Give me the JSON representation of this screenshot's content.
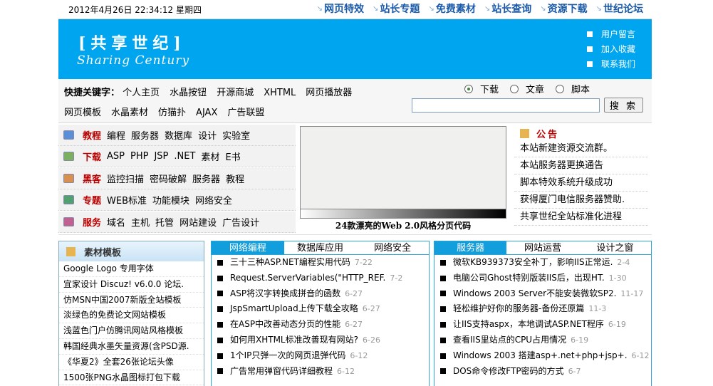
{
  "header": {
    "datetime": "2012年4月26日 22:34:12 星期四",
    "nav": [
      "网页特效",
      "站长专题",
      "免费素材",
      "站长查询",
      "资源下载",
      "世纪论坛"
    ]
  },
  "banner": {
    "logo_cn": "[共享世纪]",
    "logo_en": "Sharing Century",
    "links": [
      "用户留言",
      "加入收藏",
      "联系我们"
    ]
  },
  "search": {
    "keywords_label": "快捷关键字：",
    "keywords": [
      "个人主页",
      "水晶按钮",
      "开源商城",
      "XHTML",
      "网页播放器",
      "网页模板",
      "水晶素材",
      "仿猫扑",
      "AJAX",
      "广告联盟"
    ],
    "options": [
      {
        "label": "下载",
        "checked": true
      },
      {
        "label": "文章",
        "checked": false
      },
      {
        "label": "脚本",
        "checked": false
      }
    ],
    "input_value": "",
    "button_label": "搜 索"
  },
  "categories": [
    {
      "name": "教程",
      "links": [
        "编程",
        "服务器",
        "数据库",
        "设计",
        "实验室"
      ],
      "icon": "monitor-icon"
    },
    {
      "name": "下载",
      "links": [
        "ASP",
        "PHP",
        "JSP",
        ".NET",
        "素材",
        "E书"
      ],
      "icon": "download-icon"
    },
    {
      "name": "黑客",
      "links": [
        "监控扫描",
        "密码破解",
        "服务器",
        "教程"
      ],
      "icon": "user-icon"
    },
    {
      "name": "专题",
      "links": [
        "WEB标准",
        "功能模块",
        "网络安全"
      ],
      "icon": "image-icon"
    },
    {
      "name": "服务",
      "links": [
        "域名",
        "主机",
        "托管",
        "网站建设",
        "广告设计"
      ],
      "icon": "palette-icon"
    }
  ],
  "feature": {
    "caption": "24款漂亮的Web 2.0风格分页代码"
  },
  "notice": {
    "title": "公告",
    "items": [
      "本站新建资源交流群。",
      "本站服务器更换通告",
      "脚本特效系统升级成功",
      "获得厦门电信服务器赞助.",
      "共享世纪全站标准化进程"
    ]
  },
  "templates": {
    "title": "素材模板",
    "items": [
      "Google Logo 专用字体",
      "宜家设计 Discuz! v6.0.0 论坛.",
      "仿MSN中国2007新版全站模板",
      "淡绿色的免费论文网站模板",
      "浅蓝色门户仿腾讯网站风格模板",
      "韩国经典水墨矢量资源(含PSD源.",
      "《华夏2》全套26张论坛头像",
      "1500张PNG水晶图标打包下载"
    ]
  },
  "panel1": {
    "tabs": [
      "网络编程",
      "数据库应用",
      "网络安全"
    ],
    "active": 0,
    "items": [
      {
        "title": "三十三种ASP.NET编程实用代码",
        "date": "7-22"
      },
      {
        "title": "Request.ServerVariables(\"HTTP_REF.",
        "date": "7-2"
      },
      {
        "title": "ASP将汉字转换成拼音的函数",
        "date": "6-27"
      },
      {
        "title": "JspSmartUpload上传下载全攻略",
        "date": "6-27"
      },
      {
        "title": "在ASP中改善动态分页的性能",
        "date": "6-27"
      },
      {
        "title": "如何用XHTML标准改善现有网站?",
        "date": "6-26"
      },
      {
        "title": "1个IP只弹一次的网页退弹代码",
        "date": "6-12"
      },
      {
        "title": "广告常用弹窗代码详细教程",
        "date": "6-12"
      }
    ]
  },
  "panel2": {
    "tabs": [
      "服务器",
      "网站运营",
      "设计之窗"
    ],
    "active": 0,
    "items": [
      {
        "title": "微软KB939373安全补丁，影响IIS正常运.",
        "date": "2-4"
      },
      {
        "title": "电脑公司Ghost特别版装IIS后，出现HT.",
        "date": "1-30"
      },
      {
        "title": "Windows 2003 Server不能安装微软SP2.",
        "date": "11-17"
      },
      {
        "title": "轻松维护好你的服务器-备份还原篇",
        "date": "11-3"
      },
      {
        "title": "让IIS支持aspx，本地调试ASP.NET程序",
        "date": "6-19"
      },
      {
        "title": "查看IIS里站点的CPU占用情况",
        "date": "6-19"
      },
      {
        "title": "Windows 2003 搭建asp+.net+php+jsp+.",
        "date": "6-12"
      },
      {
        "title": "DOS命令修改FTP密码的方式",
        "date": "6-7"
      }
    ]
  },
  "colors": {
    "banner": "#00a5ef",
    "nav": "#1a5aa8",
    "accent": "#b00000",
    "tab_active": "#129edc"
  }
}
